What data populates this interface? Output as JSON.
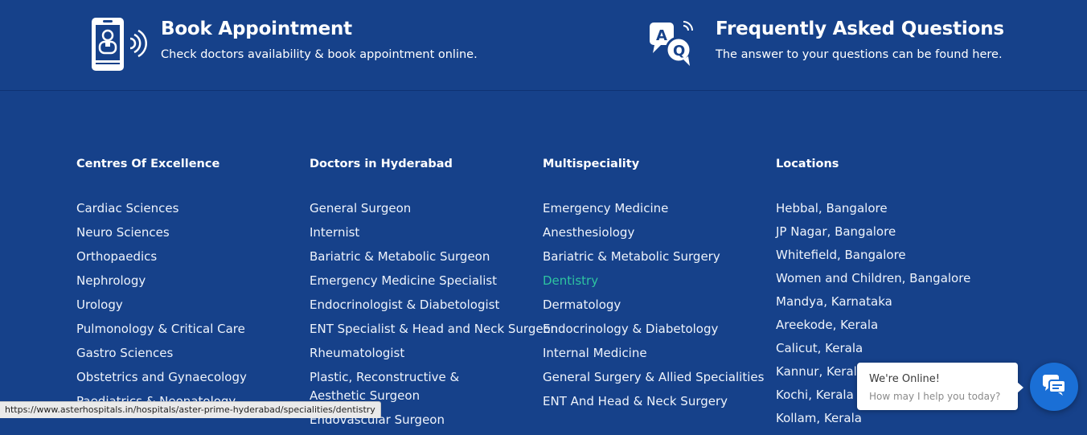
{
  "cta": {
    "book": {
      "title": "Book Appointment",
      "description": "Check doctors availability & book appointment online.",
      "icon": "phone-doctor-icon"
    },
    "faq": {
      "title": "Frequently Asked Questions",
      "description": "The answer to your questions can be found here.",
      "icon": "qa-bubbles-icon"
    }
  },
  "footer": {
    "columns": [
      {
        "heading": "Centres Of Excellence",
        "items": [
          "Cardiac Sciences",
          "Neuro Sciences",
          "Orthopaedics",
          "Nephrology",
          "Urology",
          "Pulmonology & Critical Care",
          "Gastro Sciences",
          "Obstetrics and Gynaecology",
          "Paediatrics & Neonatology"
        ]
      },
      {
        "heading": "Doctors in Hyderabad",
        "items": [
          "General Surgeon",
          "Internist",
          "Bariatric & Metabolic Surgeon",
          "Emergency Medicine Specialist",
          "Endocrinologist & Diabetologist",
          "ENT Specialist & Head and Neck Surgeon",
          "Rheumatologist",
          "Plastic, Reconstructive & Aesthetic Surgeon",
          "Endovascular Surgeon"
        ]
      },
      {
        "heading": "Multispeciality",
        "items": [
          "Emergency Medicine",
          "Anesthesiology",
          "Bariatric & Metabolic Surgery",
          "Dentistry",
          "Dermatology",
          "Endocrinology & Diabetology",
          "Internal Medicine",
          "General Surgery & Allied Specialities",
          "ENT And Head & Neck Surgery"
        ],
        "active_item": "Dentistry"
      },
      {
        "heading": "Locations",
        "items": [
          "Hebbal, Bangalore",
          "JP Nagar, Bangalore",
          "Whitefield, Bangalore",
          "Women and Children, Bangalore",
          "Mandya, Karnataka",
          "Areekode, Kerala",
          "Calicut, Kerala",
          "Kannur, Kerala",
          "Kochi, Kerala",
          "Kollam, Kerala"
        ]
      }
    ]
  },
  "status_bar": {
    "url": "https://www.asterhospitals.in/hospitals/aster-prime-hyderabad/specialities/dentistry"
  },
  "chat": {
    "title": "We're Online!",
    "subtitle": "How may I help you today?",
    "icon": "chat-bubbles-icon"
  },
  "colors": {
    "background": "#16418a",
    "active_link": "#2ec4a0",
    "chat_button": "#1a6fd6"
  }
}
